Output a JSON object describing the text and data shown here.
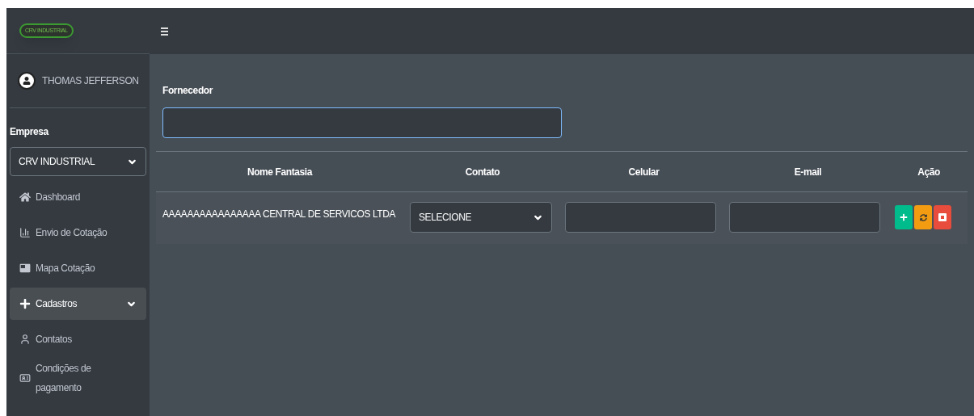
{
  "logo": {
    "text": "CRV INDUSTRIAL"
  },
  "user": {
    "name": "THOMAS JEFFERSON"
  },
  "company": {
    "label": "Empresa",
    "value": "CRV INDUSTRIAL"
  },
  "sidebar": {
    "items": [
      {
        "label": "Dashboard",
        "kind": "home",
        "selected": false,
        "has_submenu": false
      },
      {
        "label": "Envio de Cotação",
        "kind": "chart",
        "selected": false,
        "has_submenu": false
      },
      {
        "label": "Mapa Cotação",
        "kind": "card",
        "selected": false,
        "has_submenu": false
      },
      {
        "label": "Cadastros",
        "kind": "plus",
        "selected": true,
        "has_submenu": true
      },
      {
        "label": "Contatos",
        "kind": "person",
        "selected": false,
        "has_submenu": false
      },
      {
        "label": "Condições de pagamento",
        "kind": "idcard",
        "selected": false,
        "has_submenu": false
      }
    ]
  },
  "form": {
    "label": "Fornecedor"
  },
  "table": {
    "columns": [
      "Nome Fantasia",
      "Contato",
      "Celular",
      "E-mail",
      "Ação"
    ],
    "rows": [
      {
        "name": "AAAAAAAAAAAAAAAA CENTRAL DE SERVICOS LTDA",
        "contato": "SELECIONE",
        "actions": [
          {
            "kind": "add"
          },
          {
            "kind": "refresh"
          },
          {
            "kind": "delete"
          }
        ]
      }
    ]
  }
}
